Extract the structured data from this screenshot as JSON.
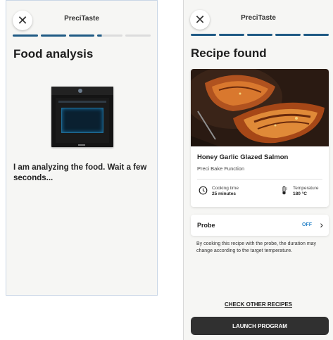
{
  "left_screen": {
    "app_title": "PreciTaste",
    "progress": {
      "segments_total": 5,
      "segments_completed": 3,
      "current_segment_fill": 0.18
    },
    "heading": "Food analysis",
    "message": "I am analyzing the food. Wait a few seconds..."
  },
  "right_screen": {
    "app_title": "PreciTaste",
    "progress": {
      "segments_total": 5,
      "segments_completed": 5
    },
    "heading": "Recipe found",
    "recipe": {
      "name": "Honey Garlic Glazed Salmon",
      "function": "Preci Bake Function",
      "cooking_time_label": "Cooking time",
      "cooking_time_value": "25 minutes",
      "temperature_label": "Temperature",
      "temperature_value": "180 °C"
    },
    "probe": {
      "label": "Probe",
      "status": "OFF",
      "description": "By cooking this recipe with the probe, the duration may change according to the target temperature."
    },
    "check_other_label": "CHECK OTHER RECIPES",
    "launch_label": "LAUNCH PROGRAM"
  },
  "icons": {
    "close": "close-icon",
    "clock": "clock-icon",
    "thermometer": "thermometer-icon",
    "chevron": "chevron-right-icon"
  },
  "colors": {
    "progress_active": "#1f5a84",
    "progress_inactive": "#dcdcdc",
    "probe_status": "#2d86c9",
    "launch_button": "#303030"
  }
}
